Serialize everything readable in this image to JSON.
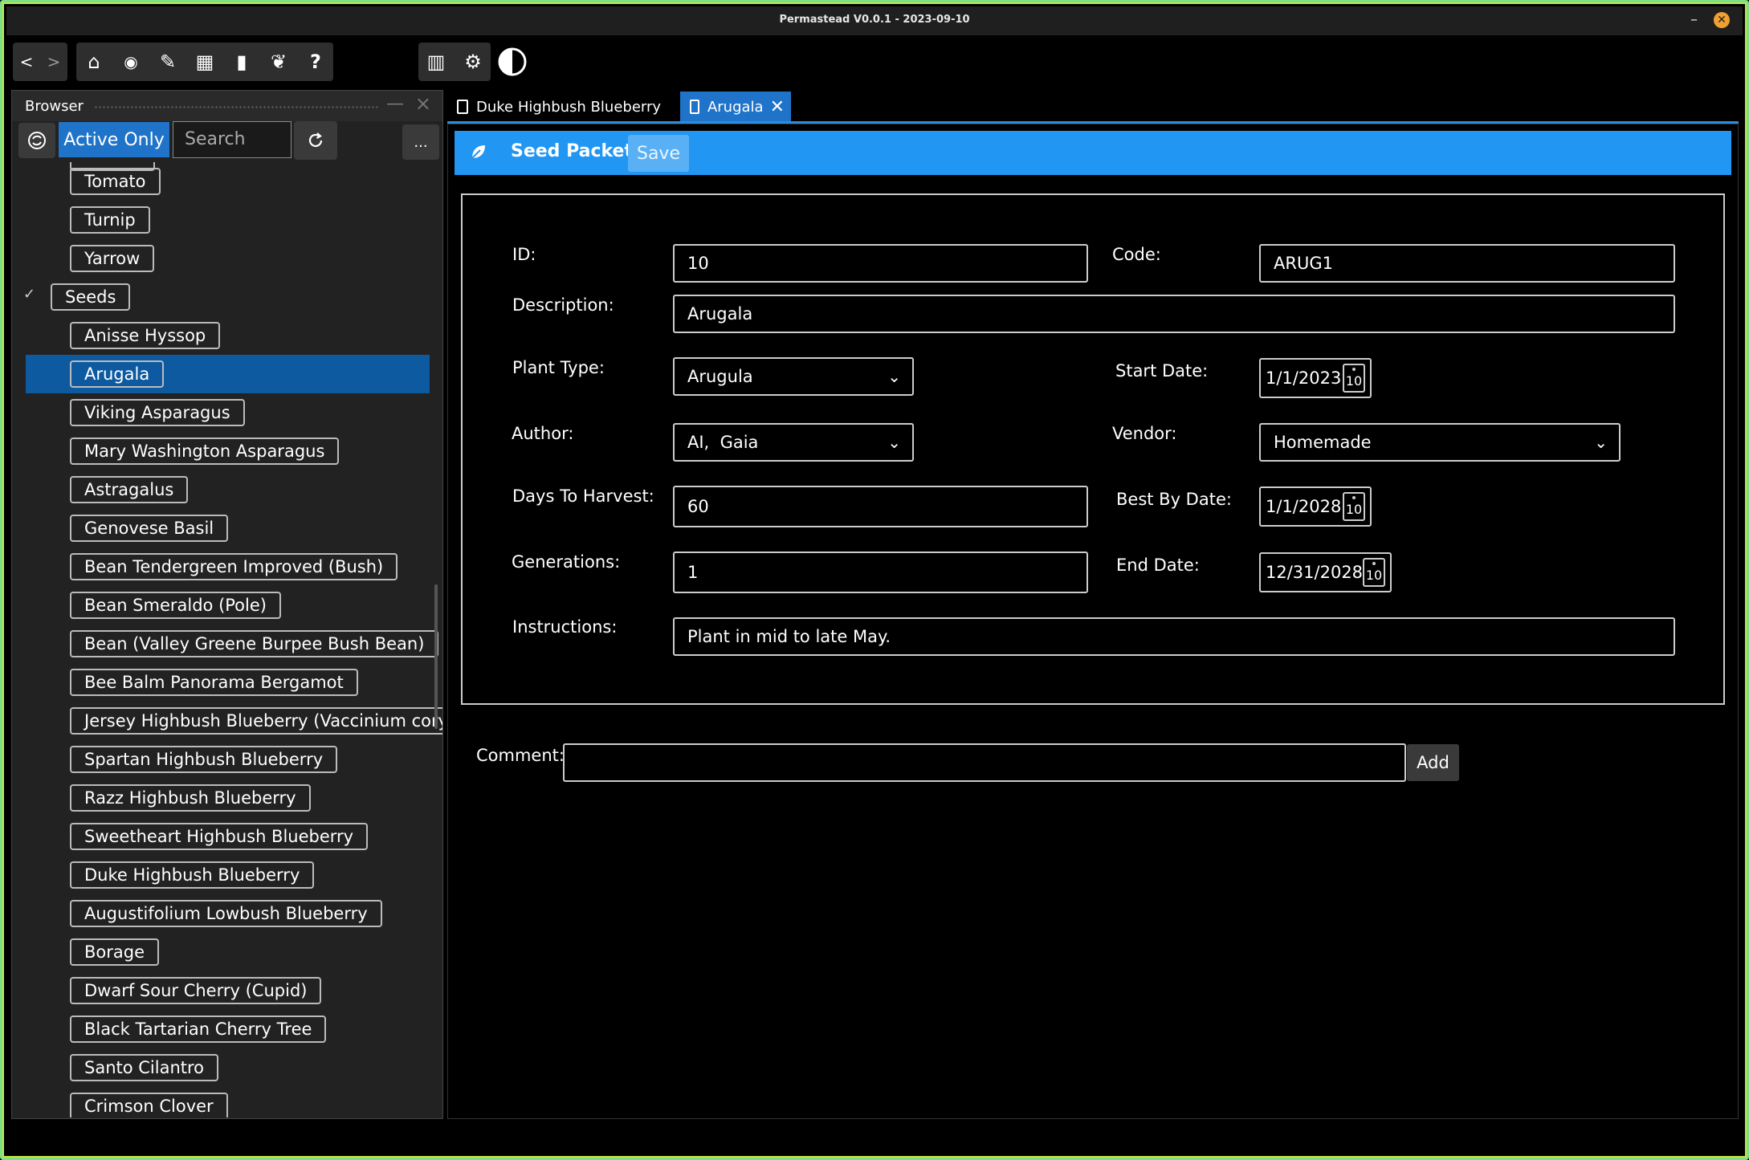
{
  "window": {
    "title": "Permastead V0.0.1 - 2023-09-10",
    "minimize": "–",
    "close": "✕"
  },
  "toolbar": {
    "nav": [
      {
        "icon": "back-icon",
        "glyph": "<"
      },
      {
        "icon": "forward-icon",
        "glyph": ">"
      }
    ],
    "main": [
      {
        "icon": "home-icon",
        "glyph": "⌂"
      },
      {
        "icon": "eye-icon",
        "glyph": "◉"
      },
      {
        "icon": "tool-icon",
        "glyph": "✎"
      },
      {
        "icon": "calendar-icon",
        "glyph": "▦"
      },
      {
        "icon": "clipboard-icon",
        "glyph": "▮"
      },
      {
        "icon": "plant-icon",
        "glyph": "❦"
      },
      {
        "icon": "help-icon",
        "glyph": "?"
      }
    ],
    "right": [
      {
        "icon": "building-icon",
        "glyph": "▥"
      },
      {
        "icon": "gear-icon",
        "glyph": "⚙"
      }
    ],
    "theme_icon": "contrast-icon"
  },
  "browser": {
    "title": "Browser",
    "active_only": "Active Only",
    "search_placeholder": "Search",
    "more": "...",
    "items": [
      {
        "label": "Tomato",
        "level": 2
      },
      {
        "label": "Turnip",
        "level": 2
      },
      {
        "label": "Yarrow",
        "level": 2
      },
      {
        "label": "Seeds",
        "level": 1,
        "checked": true
      },
      {
        "label": "Anisse Hyssop",
        "level": 2
      },
      {
        "label": "Arugala",
        "level": 2,
        "selected": true
      },
      {
        "label": "Viking Asparagus",
        "level": 2
      },
      {
        "label": "Mary Washington Asparagus",
        "level": 2
      },
      {
        "label": "Astragalus",
        "level": 2
      },
      {
        "label": "Genovese Basil",
        "level": 2
      },
      {
        "label": "Bean Tendergreen Improved (Bush)",
        "level": 2
      },
      {
        "label": "Bean Smeraldo (Pole)",
        "level": 2
      },
      {
        "label": "Bean (Valley Greene Burpee Bush Bean)",
        "level": 2
      },
      {
        "label": "Bee Balm Panorama Bergamot",
        "level": 2
      },
      {
        "label": "Jersey Highbush Blueberry (Vaccinium cory",
        "level": 2
      },
      {
        "label": "Spartan Highbush Blueberry",
        "level": 2
      },
      {
        "label": "Razz Highbush Blueberry",
        "level": 2
      },
      {
        "label": "Sweetheart Highbush Blueberry",
        "level": 2
      },
      {
        "label": "Duke Highbush Blueberry",
        "level": 2
      },
      {
        "label": "Augustifolium Lowbush Blueberry",
        "level": 2
      },
      {
        "label": "Borage",
        "level": 2
      },
      {
        "label": "Dwarf Sour Cherry (Cupid)",
        "level": 2
      },
      {
        "label": "Black Tartarian Cherry Tree",
        "level": 2
      },
      {
        "label": "Santo Cilantro",
        "level": 2
      },
      {
        "label": "Crimson Clover",
        "level": 2
      }
    ]
  },
  "tabs": [
    {
      "label": "Duke Highbush Blueberry",
      "active": false
    },
    {
      "label": "Arugala",
      "active": true,
      "close": "✕"
    }
  ],
  "editor": {
    "title": "Seed Packet",
    "save": "Save",
    "fields": {
      "id": {
        "label": "ID:",
        "value": "10"
      },
      "code": {
        "label": "Code:",
        "value": "ARUG1"
      },
      "description": {
        "label": "Description:",
        "value": "Arugala"
      },
      "plant_type": {
        "label": "Plant Type:",
        "value": "Arugula"
      },
      "start_date": {
        "label": "Start Date:",
        "value": "1/1/2023"
      },
      "author": {
        "label": "Author:",
        "value": "AI,  Gaia"
      },
      "vendor": {
        "label": "Vendor:",
        "value": "Homemade"
      },
      "days_to_harvest": {
        "label": "Days To Harvest:",
        "value": "60"
      },
      "best_by_date": {
        "label": "Best By Date:",
        "value": "1/1/2028"
      },
      "generations": {
        "label": "Generations:",
        "value": "1"
      },
      "end_date": {
        "label": "End Date:",
        "value": "12/31/2028"
      },
      "instructions": {
        "label": "Instructions:",
        "value": "Plant in mid to late May."
      }
    },
    "calendar_day": "10",
    "comment_label": "Comment:",
    "comment_value": "",
    "add": "Add"
  }
}
